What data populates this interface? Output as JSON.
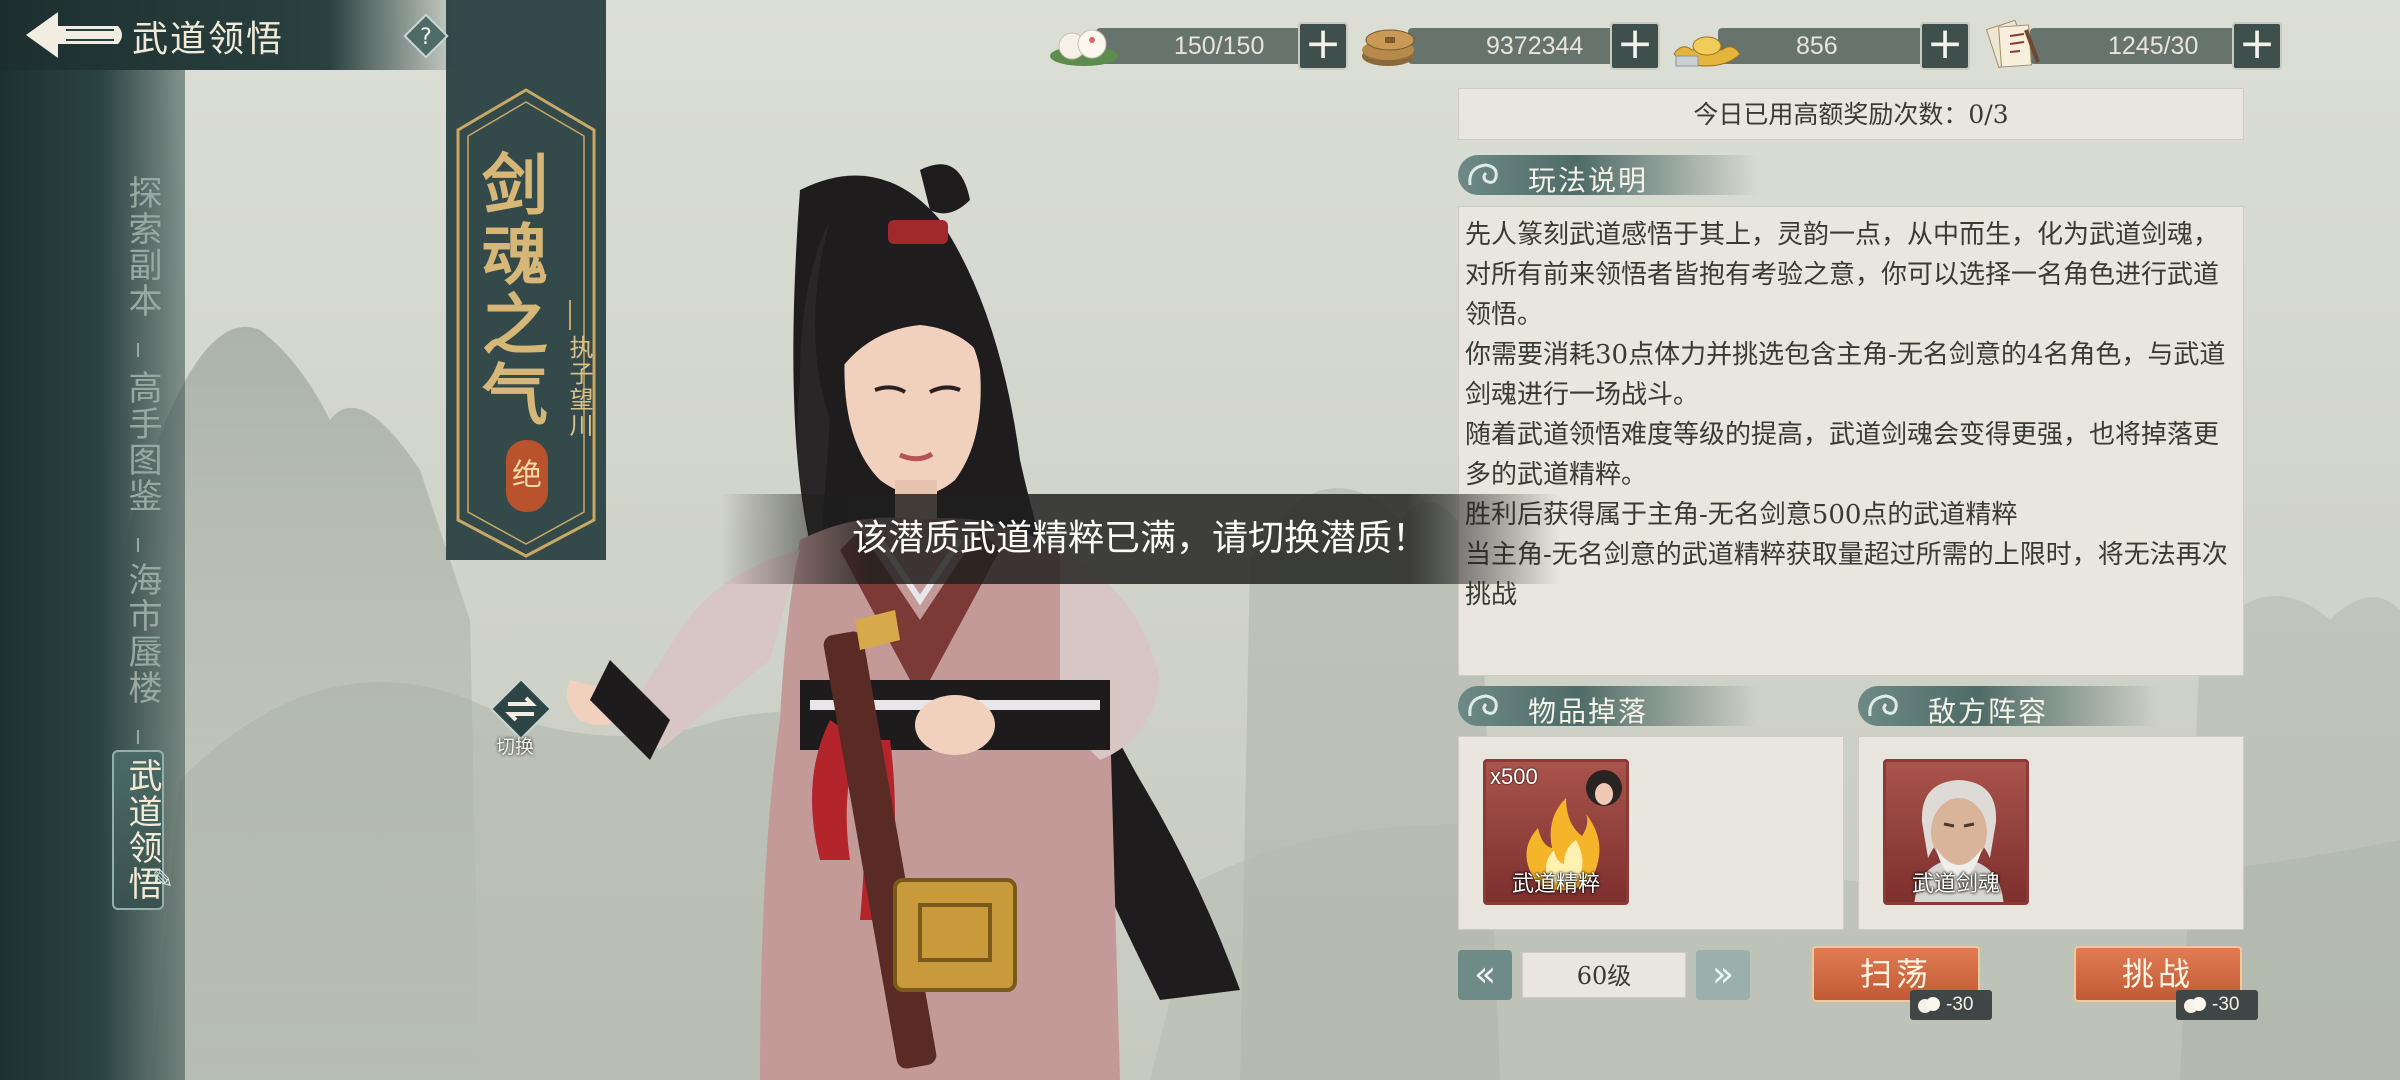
{
  "header": {
    "title": "武道领悟",
    "help_label": "?"
  },
  "resources": [
    {
      "icon": "stamina-bun-icon",
      "value": "150/150"
    },
    {
      "icon": "copper-coins-icon",
      "value": "9372344"
    },
    {
      "icon": "gold-ingot-icon",
      "value": "856"
    },
    {
      "icon": "ticket-scroll-icon",
      "value": "1245/30"
    }
  ],
  "sidebar": {
    "items": [
      {
        "label": "探索副本",
        "active": false
      },
      {
        "label": "高手图鉴",
        "active": false
      },
      {
        "label": "海市蜃楼",
        "active": false
      },
      {
        "label": "武道领悟",
        "active": true
      }
    ]
  },
  "banner": {
    "title": "剑魂之气",
    "subtitle": "执子望川",
    "grade": "绝"
  },
  "switch": {
    "label": "切换"
  },
  "panel": {
    "reward_count": "今日已用高额奖励次数：0/3",
    "rules_header": "玩法说明",
    "rules_lines": [
      "先人篆刻武道感悟于其上，灵韵一点，从中而生，化为武道剑魂，对所有前来领悟者皆抱有考验之意，你可以选择一名角色进行武道领悟。",
      "你需要消耗30点体力并挑选包含主角-无名剑意的4名角色，与武道剑魂进行一场战斗。",
      "随着武道领悟难度等级的提高，武道剑魂会变得更强，也将掉落更多的武道精粹。",
      "胜利后获得属于主角-无名剑意500点的武道精粹",
      "当主角-无名剑意的武道精粹获取量超过所需的上限时，将无法再次挑战"
    ],
    "drops_header": "物品掉落",
    "enemies_header": "敌方阵容",
    "drop_item": {
      "qty": "x500",
      "label": "武道精粹"
    },
    "enemy": {
      "label": "武道剑魂"
    },
    "level": "60级",
    "prev_label": "«",
    "next_label": "»",
    "sweep_label": "扫荡",
    "challenge_label": "挑战",
    "sweep_cost": "-30",
    "challenge_cost": "-30"
  },
  "toast": "该潜质武道精粹已满，请切换潜质！",
  "colors": {
    "sidebar": "#2b4342",
    "accent_teal": "#6f8b87",
    "action_orange": "#c15a36",
    "panel_bg": "#e9e6de",
    "banner_gold": "#d6b778"
  }
}
